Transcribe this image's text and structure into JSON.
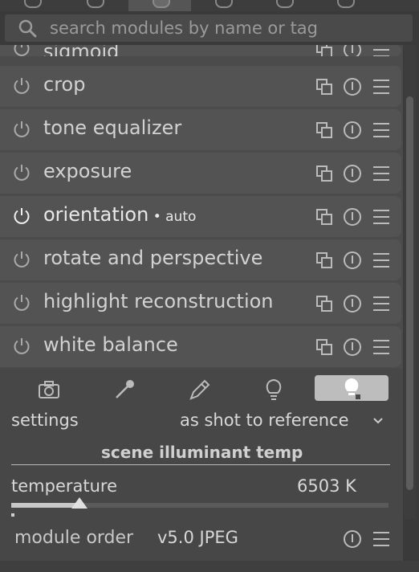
{
  "search": {
    "placeholder": "search modules by name or tag"
  },
  "modules": [
    {
      "name": "sigmoid",
      "suffix": "",
      "enabled": false
    },
    {
      "name": "crop",
      "suffix": "",
      "enabled": false
    },
    {
      "name": "tone equalizer",
      "suffix": "",
      "enabled": false
    },
    {
      "name": "exposure",
      "suffix": "",
      "enabled": false
    },
    {
      "name": "orientation",
      "suffix": " • auto",
      "enabled": true
    },
    {
      "name": "rotate and perspective",
      "suffix": "",
      "enabled": false
    },
    {
      "name": "highlight reconstruction",
      "suffix": "",
      "enabled": false
    },
    {
      "name": "white balance",
      "suffix": "",
      "enabled": false
    }
  ],
  "white_balance": {
    "settings_label": "settings",
    "settings_value": "as shot to reference",
    "section_title": "scene illuminant temp",
    "temperature_label": "temperature",
    "temperature_value": "6503 K",
    "temperature_fraction": 0.18,
    "tabs": [
      "camera-icon",
      "eyedropper-icon",
      "pencil-icon",
      "bulb-icon",
      "bulb-filled-icon"
    ]
  },
  "footer": {
    "label": "module order",
    "value": "v5.0 JPEG"
  }
}
